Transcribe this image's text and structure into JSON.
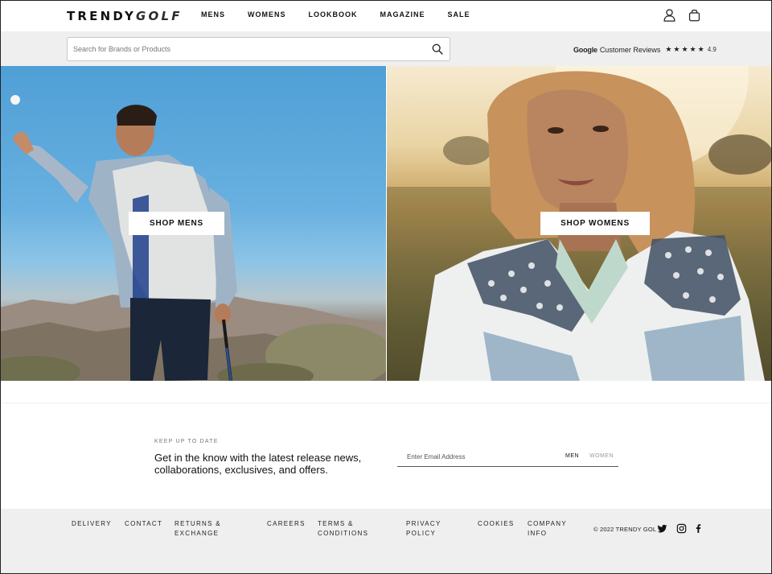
{
  "header": {
    "logo_bold": "TRENDY",
    "logo_light": "GOLF",
    "nav": [
      "MENS",
      "WOMENS",
      "LOOKBOOK",
      "MAGAZINE",
      "SALE"
    ]
  },
  "search": {
    "placeholder": "Search for Brands or Products",
    "value": ""
  },
  "reviews": {
    "brand": "Google",
    "label": "Customer Reviews",
    "stars": "★★★★★",
    "rating": "4.9"
  },
  "hero": {
    "shop_mens": "SHOP MENS",
    "shop_womens": "SHOP WOMENS"
  },
  "newsletter": {
    "kicker": "KEEP UP TO DATE",
    "text": "Get in the know with the latest release news, collaborations, exclusives, and offers.",
    "email_placeholder": "Enter Email Address",
    "men": "MEN",
    "women": "WOMEN"
  },
  "footer": {
    "links": {
      "delivery": "DELIVERY",
      "contact": "CONTACT",
      "returns": "RETURNS & EXCHANGE",
      "careers": "CAREERS",
      "terms": "TERMS & CONDITIONS",
      "privacy": "PRIVACY POLICY",
      "cookies": "COOKIES",
      "company": "COMPANY INFO"
    },
    "copyright": "© 2022 TRENDY GOL"
  },
  "icons": {
    "account": "user-icon",
    "bag": "shopping-bag-icon",
    "search": "search-icon",
    "twitter": "twitter-icon",
    "instagram": "instagram-icon",
    "facebook": "facebook-icon"
  }
}
